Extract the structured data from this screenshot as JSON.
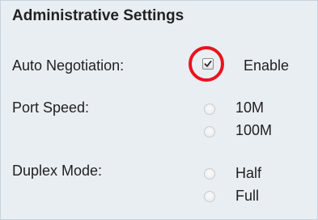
{
  "section": {
    "title": "Administrative Settings"
  },
  "auto_negotiation": {
    "label": "Auto Negotiation:",
    "checkbox_label": "Enable",
    "checked": true
  },
  "port_speed": {
    "label": "Port Speed:",
    "options": [
      "10M",
      "100M"
    ]
  },
  "duplex_mode": {
    "label": "Duplex Mode:",
    "options": [
      "Half",
      "Full"
    ]
  },
  "colors": {
    "panel_background": "#e9eef3",
    "highlight_ring": "#e8141e"
  }
}
